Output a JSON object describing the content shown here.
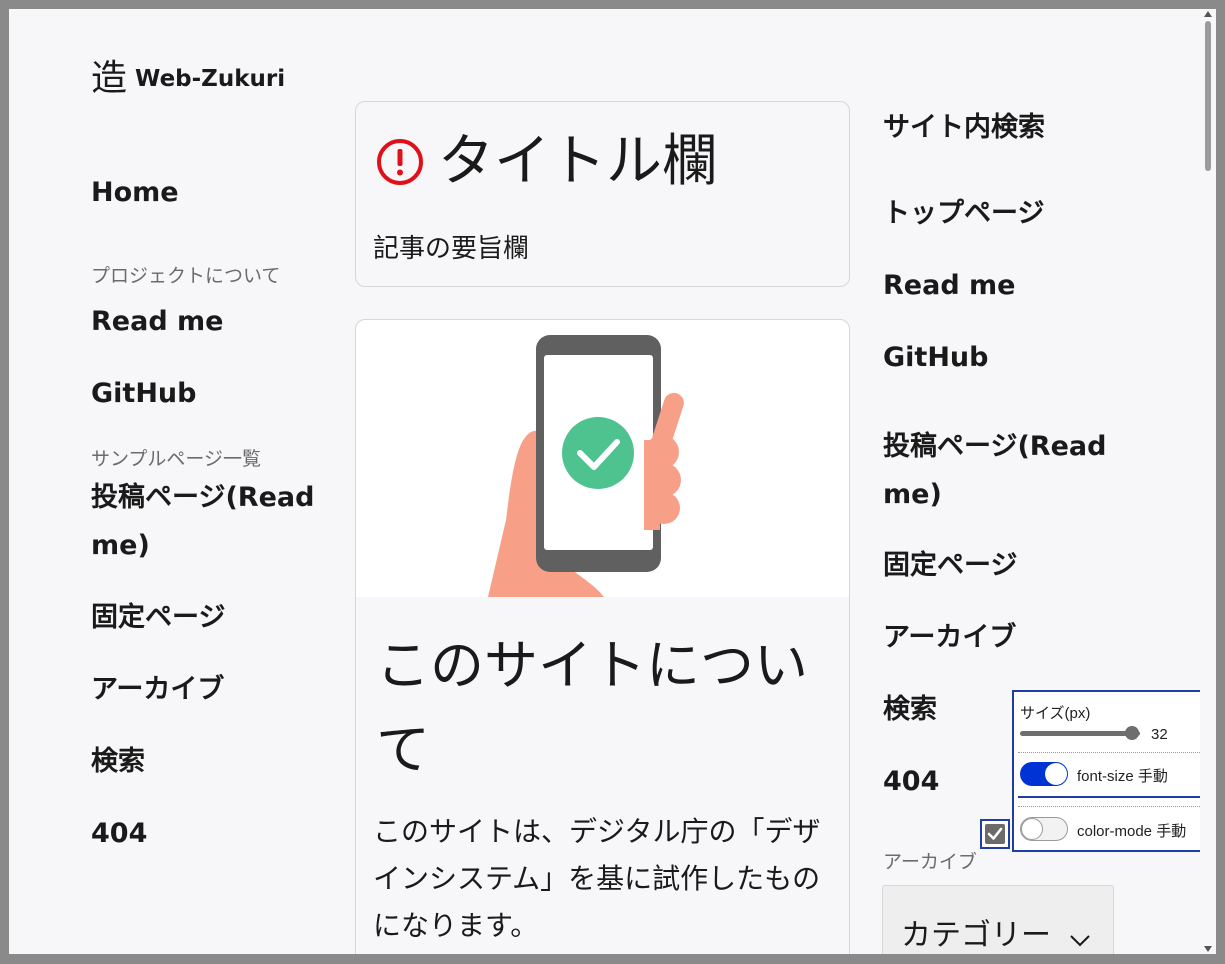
{
  "logo": {
    "mark": "造",
    "text": "Web-Zukuri"
  },
  "nav_left": {
    "home": "Home",
    "project_heading": "プロジェクトについて",
    "readme": "Read me",
    "github": "GitHub",
    "samples_heading": "サンプルページ一覧",
    "post_line1": "投稿ページ(Read",
    "post_line2": "me)",
    "fixed": "固定ページ",
    "archive": "アーカイブ",
    "search": "検索",
    "notfound": "404"
  },
  "title_card": {
    "icon": "alert-circle-icon",
    "title": "タイトル欄",
    "summary": "記事の要旨欄"
  },
  "about_card": {
    "image": "phone-check-illustration",
    "title": "このサイトについて",
    "body": "このサイトは、デジタル庁の「デザインシステム」を基に試作したものになります。"
  },
  "nav_right": {
    "site_search": "サイト内検索",
    "top": "トップページ",
    "readme": "Read me",
    "github": "GitHub",
    "post_line1": "投稿ページ(Read",
    "post_line2": "me)",
    "fixed": "固定ページ",
    "archive": "アーカイブ",
    "search": "検索",
    "notfound": "404",
    "archive_heading": "アーカイブ",
    "category_select": "カテゴリー"
  },
  "settings_panel": {
    "size_label": "サイズ(px)",
    "size_value": "32",
    "size_slider_fraction": 0.93,
    "font_size_label": "font-size 手動",
    "font_size_enabled": true,
    "color_mode_label": "color-mode 手動",
    "color_mode_enabled": false
  },
  "colors": {
    "accent": "#0033d6",
    "panel_border": "#1f3fa3",
    "alert": "#e0101a",
    "check_green": "#4ec28f",
    "hand": "#f7a087",
    "phone": "#606060"
  }
}
